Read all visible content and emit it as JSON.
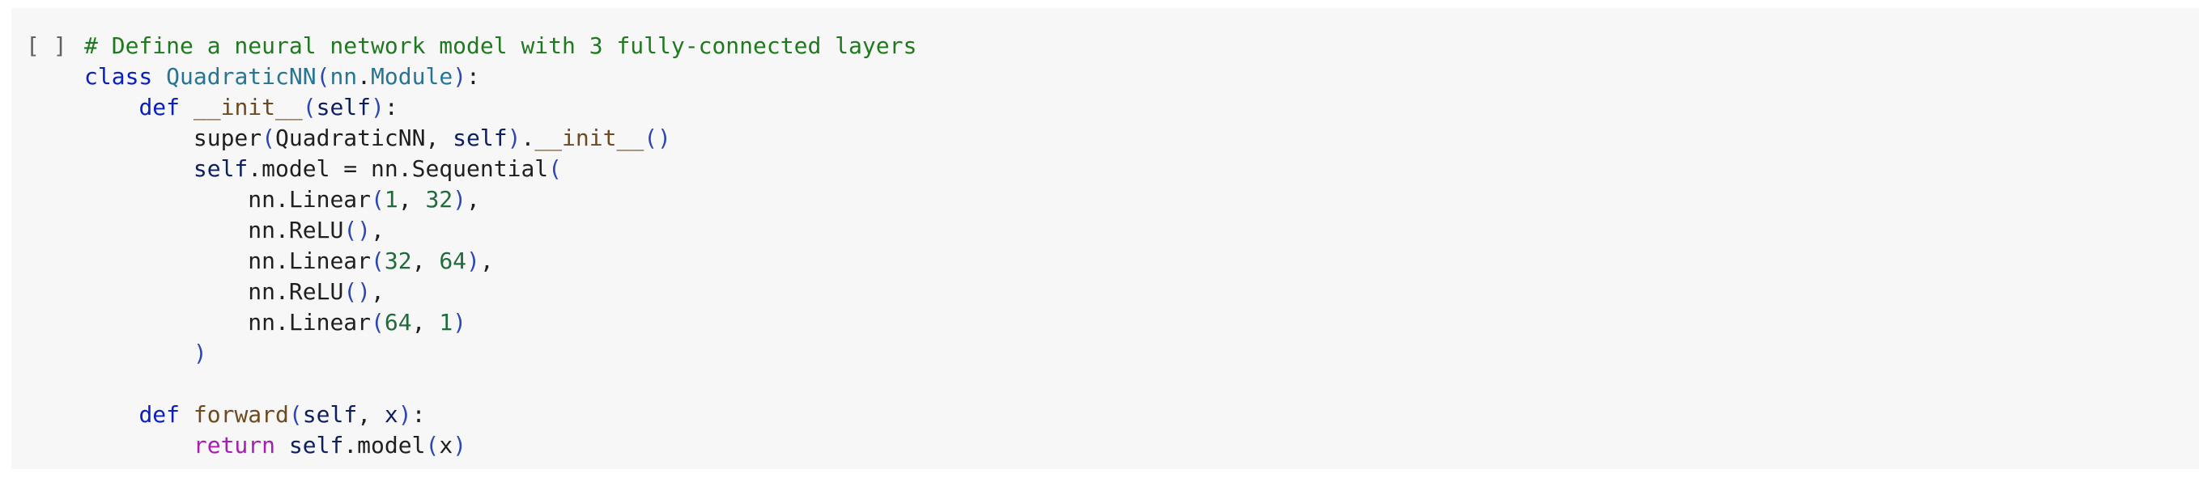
{
  "cell": {
    "prompt": "[ ]",
    "lines": [
      {
        "indent": 0,
        "tokens": [
          [
            "comment",
            "# Define a neural network model with 3 fully-connected layers"
          ]
        ]
      },
      {
        "indent": 0,
        "tokens": [
          [
            "kw",
            "class"
          ],
          [
            "plain",
            " "
          ],
          [
            "cls",
            "QuadraticNN"
          ],
          [
            "paren",
            "("
          ],
          [
            "cls",
            "nn"
          ],
          [
            "plain",
            "."
          ],
          [
            "cls",
            "Module"
          ],
          [
            "paren",
            ")"
          ],
          [
            "plain",
            ":"
          ]
        ]
      },
      {
        "indent": 4,
        "tokens": [
          [
            "kw",
            "def"
          ],
          [
            "plain",
            " "
          ],
          [
            "func",
            "__init__"
          ],
          [
            "paren",
            "("
          ],
          [
            "var",
            "self"
          ],
          [
            "paren",
            ")"
          ],
          [
            "plain",
            ":"
          ]
        ]
      },
      {
        "indent": 8,
        "tokens": [
          [
            "plain",
            "super"
          ],
          [
            "paren",
            "("
          ],
          [
            "plain",
            "QuadraticNN, "
          ],
          [
            "var",
            "self"
          ],
          [
            "paren",
            ")"
          ],
          [
            "plain",
            "."
          ],
          [
            "func",
            "__init__"
          ],
          [
            "paren",
            "()"
          ]
        ]
      },
      {
        "indent": 8,
        "tokens": [
          [
            "var",
            "self"
          ],
          [
            "plain",
            ".model = nn.Sequential"
          ],
          [
            "paren",
            "("
          ]
        ]
      },
      {
        "indent": 12,
        "tokens": [
          [
            "plain",
            "nn.Linear"
          ],
          [
            "paren",
            "("
          ],
          [
            "num",
            "1"
          ],
          [
            "plain",
            ", "
          ],
          [
            "num",
            "32"
          ],
          [
            "paren",
            ")"
          ],
          [
            "plain",
            ","
          ]
        ]
      },
      {
        "indent": 12,
        "tokens": [
          [
            "plain",
            "nn.ReLU"
          ],
          [
            "paren",
            "()"
          ],
          [
            "plain",
            ","
          ]
        ]
      },
      {
        "indent": 12,
        "tokens": [
          [
            "plain",
            "nn.Linear"
          ],
          [
            "paren",
            "("
          ],
          [
            "num",
            "32"
          ],
          [
            "plain",
            ", "
          ],
          [
            "num",
            "64"
          ],
          [
            "paren",
            ")"
          ],
          [
            "plain",
            ","
          ]
        ]
      },
      {
        "indent": 12,
        "tokens": [
          [
            "plain",
            "nn.ReLU"
          ],
          [
            "paren",
            "()"
          ],
          [
            "plain",
            ","
          ]
        ]
      },
      {
        "indent": 12,
        "tokens": [
          [
            "plain",
            "nn.Linear"
          ],
          [
            "paren",
            "("
          ],
          [
            "num",
            "64"
          ],
          [
            "plain",
            ", "
          ],
          [
            "num",
            "1"
          ],
          [
            "paren",
            ")"
          ]
        ]
      },
      {
        "indent": 8,
        "tokens": [
          [
            "paren",
            ")"
          ]
        ]
      },
      {
        "indent": 0,
        "tokens": []
      },
      {
        "indent": 4,
        "tokens": [
          [
            "kw",
            "def"
          ],
          [
            "plain",
            " "
          ],
          [
            "func",
            "forward"
          ],
          [
            "paren",
            "("
          ],
          [
            "var",
            "self"
          ],
          [
            "plain",
            ", "
          ],
          [
            "var",
            "x"
          ],
          [
            "paren",
            ")"
          ],
          [
            "plain",
            ":"
          ]
        ]
      },
      {
        "indent": 8,
        "tokens": [
          [
            "kw2",
            "return"
          ],
          [
            "plain",
            " "
          ],
          [
            "var",
            "self"
          ],
          [
            "plain",
            ".model"
          ],
          [
            "paren",
            "("
          ],
          [
            "plain",
            "x"
          ],
          [
            "paren",
            ")"
          ]
        ]
      }
    ]
  },
  "colors": {
    "background": "#f7f7f7",
    "comment": "#1f7a1f",
    "keyword": "#0b1fbf",
    "return_keyword": "#a51fb0",
    "class_name": "#277595",
    "function_name": "#6d4a1f",
    "parenthesis": "#2d48b4",
    "number": "#1f6b3c"
  }
}
